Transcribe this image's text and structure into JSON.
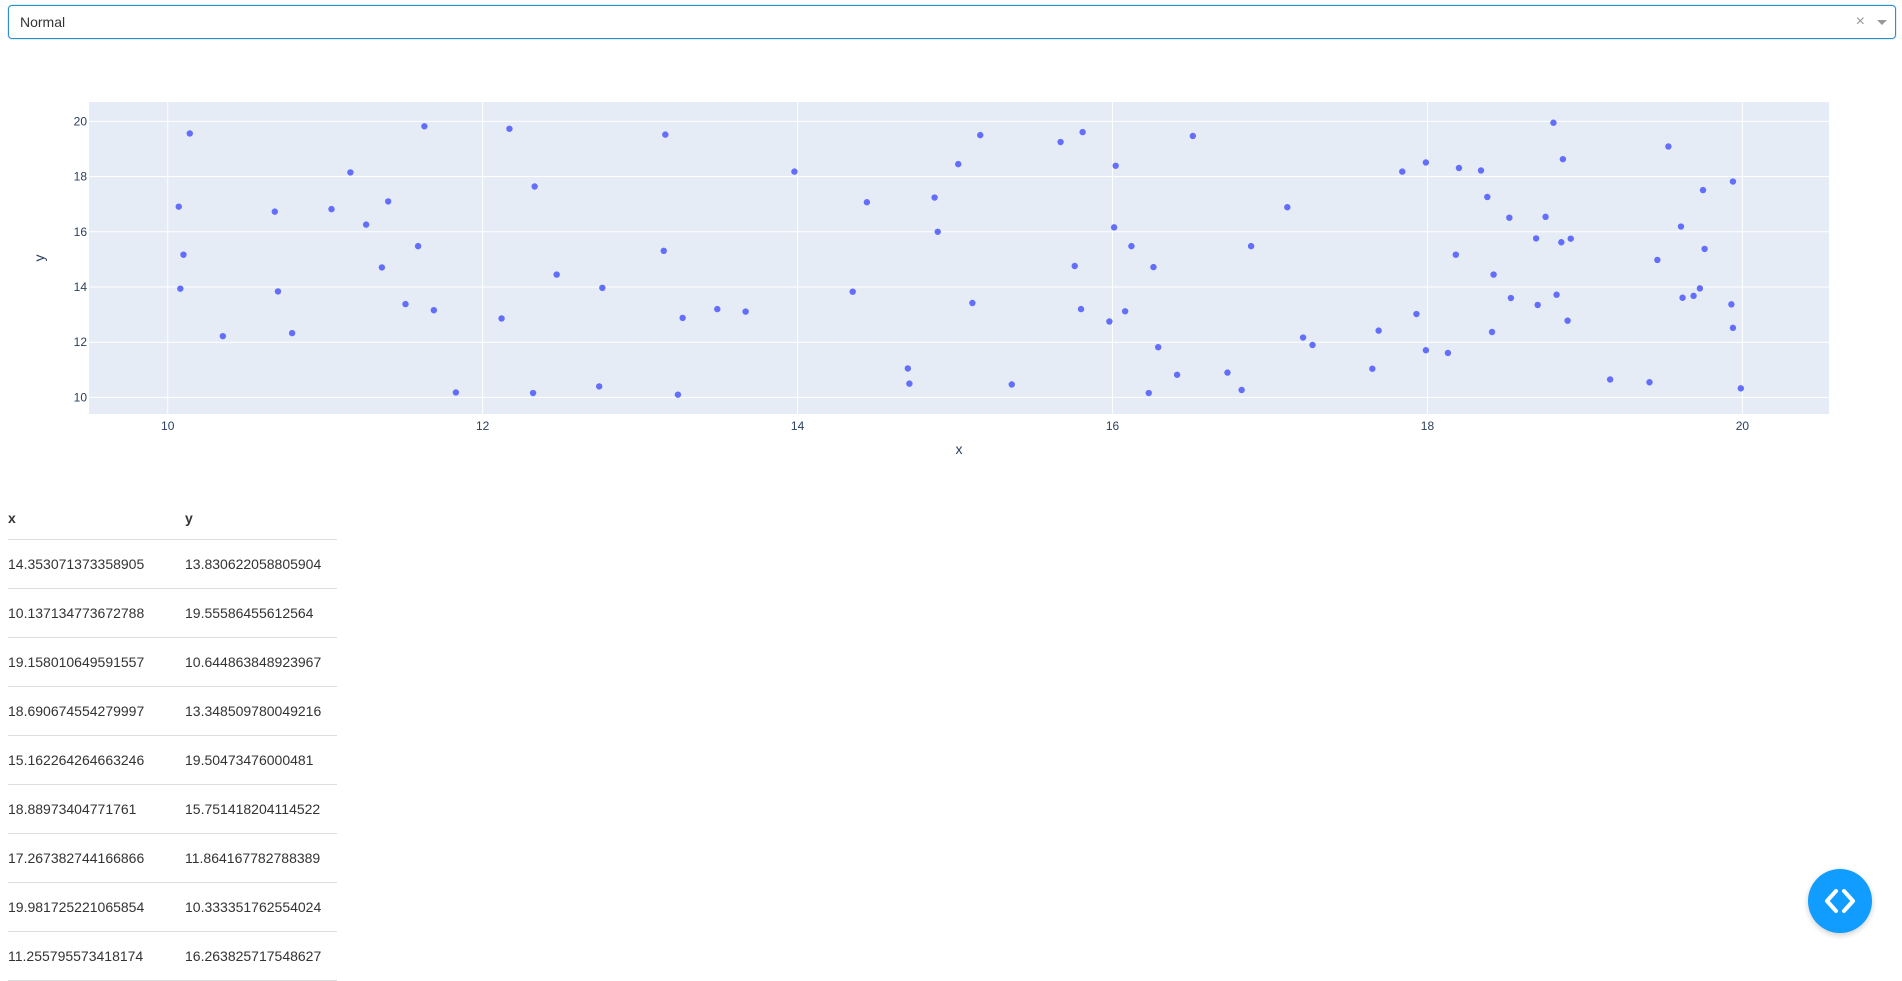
{
  "dropdown": {
    "value": "Normal",
    "clear_glyph": "×",
    "clear_icon": "close-icon",
    "arrow_icon": "chevron-down-icon"
  },
  "colors": {
    "marker": "#636efa",
    "plot_bg": "#e5ecf6",
    "grid": "#ffffff",
    "accent": "#119dff",
    "dropdown_border": "#2d8ecf"
  },
  "chart_data": {
    "type": "scatter",
    "xlabel": "x",
    "ylabel": "y",
    "xlim": [
      9.5,
      20.55
    ],
    "ylim": [
      9.4,
      20.7
    ],
    "xticks": [
      10,
      12,
      14,
      16,
      18,
      20
    ],
    "yticks": [
      10,
      12,
      14,
      16,
      18,
      20
    ],
    "grid": true,
    "legend": "none",
    "x": [
      10.07,
      10.08,
      10.1,
      10.14,
      10.35,
      10.68,
      10.7,
      10.79,
      11.04,
      11.16,
      11.26,
      11.36,
      11.4,
      11.51,
      11.59,
      11.63,
      11.69,
      11.83,
      12.12,
      12.17,
      12.32,
      12.33,
      12.47,
      12.74,
      12.76,
      13.15,
      13.16,
      13.24,
      13.27,
      13.49,
      13.67,
      13.98,
      14.35,
      14.44,
      14.7,
      14.71,
      14.87,
      14.89,
      15.02,
      15.11,
      15.16,
      15.36,
      15.67,
      15.76,
      15.8,
      15.81,
      15.98,
      16.01,
      16.02,
      16.08,
      16.12,
      16.23,
      16.26,
      16.29,
      16.41,
      16.51,
      16.73,
      16.82,
      16.88,
      17.11,
      17.21,
      17.27,
      17.65,
      17.69,
      17.84,
      17.93,
      17.99,
      17.99,
      18.13,
      18.18,
      18.2,
      18.34,
      18.38,
      18.41,
      18.42,
      18.52,
      18.53,
      18.69,
      18.7,
      18.75,
      18.8,
      18.82,
      18.85,
      18.86,
      18.89,
      18.91,
      19.16,
      19.41,
      19.46,
      19.53,
      19.61,
      19.62,
      19.69,
      19.73,
      19.75,
      19.76,
      19.93,
      19.94,
      19.94,
      19.99
    ],
    "y": [
      16.91,
      13.94,
      15.17,
      19.56,
      12.22,
      16.73,
      13.84,
      12.33,
      16.82,
      18.15,
      16.26,
      14.71,
      17.1,
      13.38,
      15.48,
      19.82,
      13.16,
      10.18,
      12.86,
      19.73,
      10.16,
      17.64,
      14.45,
      10.4,
      13.97,
      15.31,
      19.52,
      10.1,
      12.88,
      13.2,
      13.11,
      18.18,
      13.83,
      17.07,
      11.05,
      10.5,
      17.24,
      16.0,
      18.45,
      13.42,
      19.5,
      10.47,
      19.25,
      14.76,
      13.2,
      19.61,
      12.75,
      16.16,
      18.39,
      13.12,
      15.48,
      10.16,
      14.72,
      11.82,
      10.82,
      19.47,
      10.9,
      10.27,
      15.48,
      16.89,
      12.17,
      11.9,
      11.04,
      12.42,
      18.18,
      13.02,
      18.51,
      11.71,
      11.61,
      15.17,
      18.31,
      18.22,
      17.26,
      12.37,
      14.45,
      16.51,
      13.6,
      15.76,
      13.35,
      16.54,
      19.95,
      13.72,
      15.62,
      18.63,
      12.78,
      15.75,
      10.65,
      10.55,
      14.98,
      19.09,
      16.19,
      13.61,
      13.68,
      13.95,
      17.51,
      15.38,
      13.37,
      12.52,
      17.82,
      10.33
    ]
  },
  "table": {
    "headers": [
      "x",
      "y"
    ],
    "rows": [
      [
        "14.353071373358905",
        "13.830622058805904"
      ],
      [
        "10.137134773672788",
        "19.55586455612564"
      ],
      [
        "19.158010649591557",
        "10.644863848923967"
      ],
      [
        "18.690674554279997",
        "13.348509780049216"
      ],
      [
        "15.162264264663246",
        "19.50473476000481"
      ],
      [
        "18.88973404771761",
        "15.751418204114522"
      ],
      [
        "17.267382744166866",
        "11.864167782788389"
      ],
      [
        "19.981725221065854",
        "10.333351762554024"
      ],
      [
        "11.255795573418174",
        "16.263825717548627"
      ]
    ]
  },
  "code_toggle": {
    "icon": "code-icon"
  }
}
